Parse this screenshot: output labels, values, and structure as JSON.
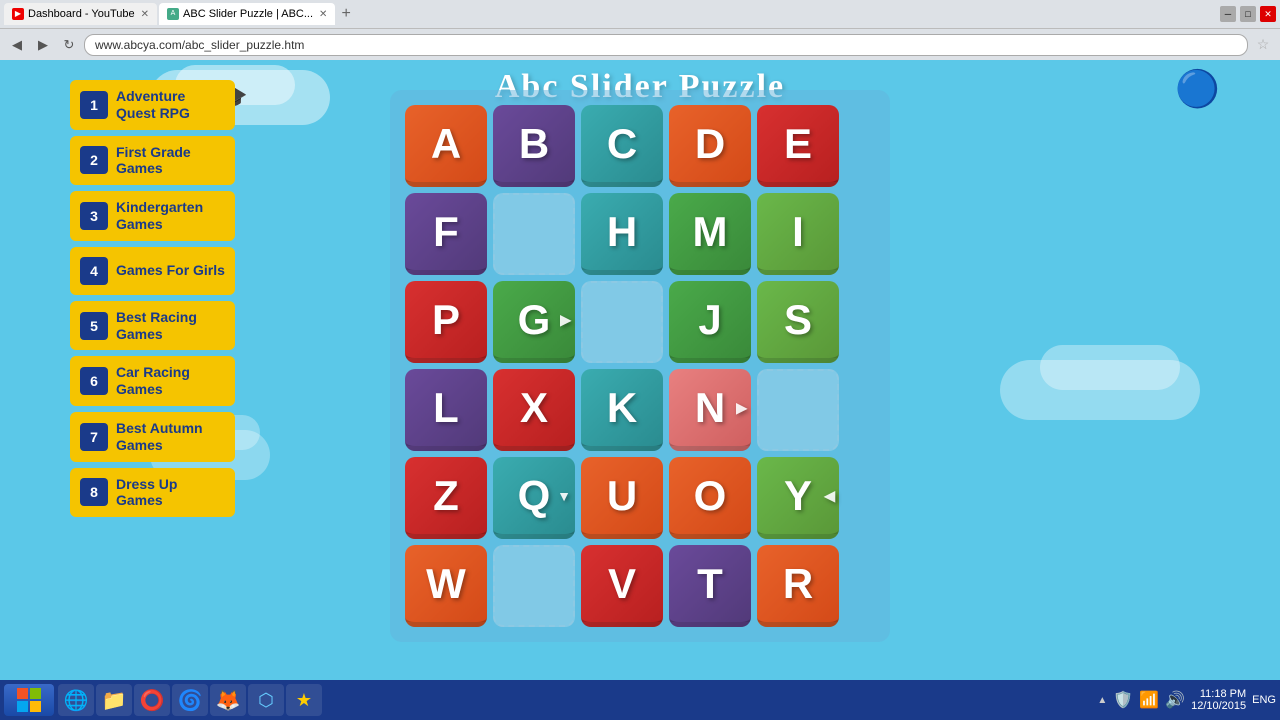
{
  "browser": {
    "tabs": [
      {
        "id": "tab1",
        "label": "Dashboard - YouTube",
        "favicon": "YT",
        "active": false
      },
      {
        "id": "tab2",
        "label": "ABC Slider Puzzle | ABC...",
        "favicon": "ABC",
        "active": true
      }
    ],
    "address": "www.abcya.com/abc_slider_puzzle.htm",
    "title": "Dashboard - YouTube"
  },
  "page": {
    "title": "Abc Slider Puzzle",
    "background_color": "#5bc8e8"
  },
  "sidebar": {
    "items": [
      {
        "num": "1",
        "label": "Adventure Quest RPG"
      },
      {
        "num": "2",
        "label": "First Grade Games"
      },
      {
        "num": "3",
        "label": "Kindergarten Games"
      },
      {
        "num": "4",
        "label": "Games For Girls"
      },
      {
        "num": "5",
        "label": "Best Racing Games"
      },
      {
        "num": "6",
        "label": "Car Racing Games"
      },
      {
        "num": "7",
        "label": "Best Autumn Games"
      },
      {
        "num": "8",
        "label": "Dress Up Games"
      }
    ]
  },
  "puzzle": {
    "grid": [
      [
        {
          "letter": "A",
          "color": "orange"
        },
        {
          "letter": "B",
          "color": "purple"
        },
        {
          "letter": "C",
          "color": "teal"
        },
        {
          "letter": "D",
          "color": "orange"
        },
        {
          "letter": "E",
          "color": "red"
        }
      ],
      [
        {
          "letter": "F",
          "color": "purple"
        },
        {
          "letter": "",
          "color": "empty"
        },
        {
          "letter": "H",
          "color": "teal"
        },
        {
          "letter": "M",
          "color": "green-dark"
        },
        {
          "letter": "I",
          "color": "green-light"
        }
      ],
      [
        {
          "letter": "P",
          "color": "red"
        },
        {
          "letter": "G",
          "color": "green-dark",
          "arrow": "▶"
        },
        {
          "letter": "",
          "color": "empty"
        },
        {
          "letter": "J",
          "color": "green-dark"
        },
        {
          "letter": "S",
          "color": "green-light"
        }
      ],
      [
        {
          "letter": "L",
          "color": "purple"
        },
        {
          "letter": "X",
          "color": "red"
        },
        {
          "letter": "K",
          "color": "teal"
        },
        {
          "letter": "N",
          "color": "pink",
          "arrow": "▶"
        },
        {
          "letter": "",
          "color": "empty"
        }
      ],
      [
        {
          "letter": "Z",
          "color": "red"
        },
        {
          "letter": "Q",
          "color": "teal",
          "arrow": "▼"
        },
        {
          "letter": "U",
          "color": "orange"
        },
        {
          "letter": "O",
          "color": "orange"
        },
        {
          "letter": "Y",
          "color": "green-light",
          "arrow": "◀"
        }
      ],
      [
        {
          "letter": "W",
          "color": "orange"
        },
        {
          "letter": "",
          "color": "empty"
        },
        {
          "letter": "V",
          "color": "red"
        },
        {
          "letter": "T",
          "color": "purple"
        },
        {
          "letter": "R",
          "color": "orange"
        }
      ]
    ]
  },
  "taskbar": {
    "time": "11:18 PM",
    "date": "12/10/2015",
    "language": "ENG",
    "apps": [
      "⊞",
      "🌐",
      "📁",
      "◉",
      "🦊",
      "🔵",
      "⬛",
      "⬛"
    ]
  }
}
